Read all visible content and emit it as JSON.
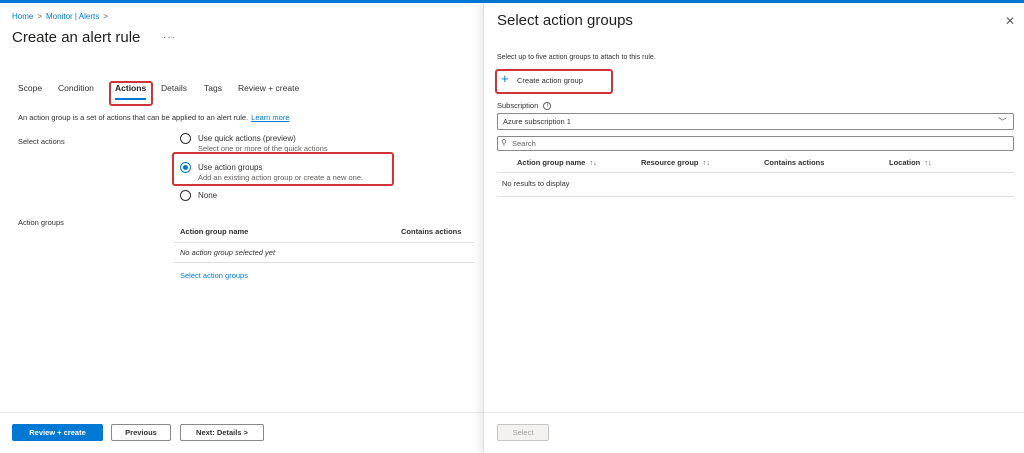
{
  "breadcrumb": {
    "items": [
      "Home",
      "Monitor | Alerts"
    ],
    "separator": ">"
  },
  "page": {
    "title": "Create an alert rule",
    "more": "···"
  },
  "tabs": [
    "Scope",
    "Condition",
    "Actions",
    "Details",
    "Tags",
    "Review + create"
  ],
  "active_tab": "Actions",
  "info": {
    "text": "An action group is a set of actions that can be applied to an alert rule.",
    "link": "Learn more"
  },
  "select_actions": {
    "label": "Select actions",
    "options": [
      {
        "label": "Use quick actions (preview)",
        "sub": "Select one or more of the quick actions",
        "checked": false
      },
      {
        "label": "Use action groups",
        "sub": "Add an existing action group or create a new one.",
        "checked": true
      },
      {
        "label": "None",
        "sub": "",
        "checked": false
      }
    ]
  },
  "action_groups": {
    "label": "Action groups",
    "columns": [
      "Action group name",
      "Contains actions"
    ],
    "empty": "No action group selected yet",
    "link": "Select action groups"
  },
  "footer": {
    "review": "Review + create",
    "previous": "Previous",
    "next": "Next: Details >"
  },
  "panel": {
    "title": "Select action groups",
    "close": "✕",
    "description": "Select up to five action groups to attach to this rule.",
    "create_button": "Create action group",
    "subscription_label": "Subscription",
    "subscription_value": "Azure subscription 1",
    "search_placeholder": "Search",
    "columns": [
      "Action group name",
      "Resource group",
      "Contains actions",
      "Location"
    ],
    "sort_glyph": "↑↓",
    "empty": "No results to display",
    "select_button": "Select"
  },
  "colors": {
    "accent": "#0078d4",
    "highlight": "#d13438"
  },
  "icons": {
    "close": "close-icon",
    "plus": "plus-icon",
    "search": "search-icon",
    "chevron": "chevron-down-icon",
    "info": "info-icon"
  }
}
